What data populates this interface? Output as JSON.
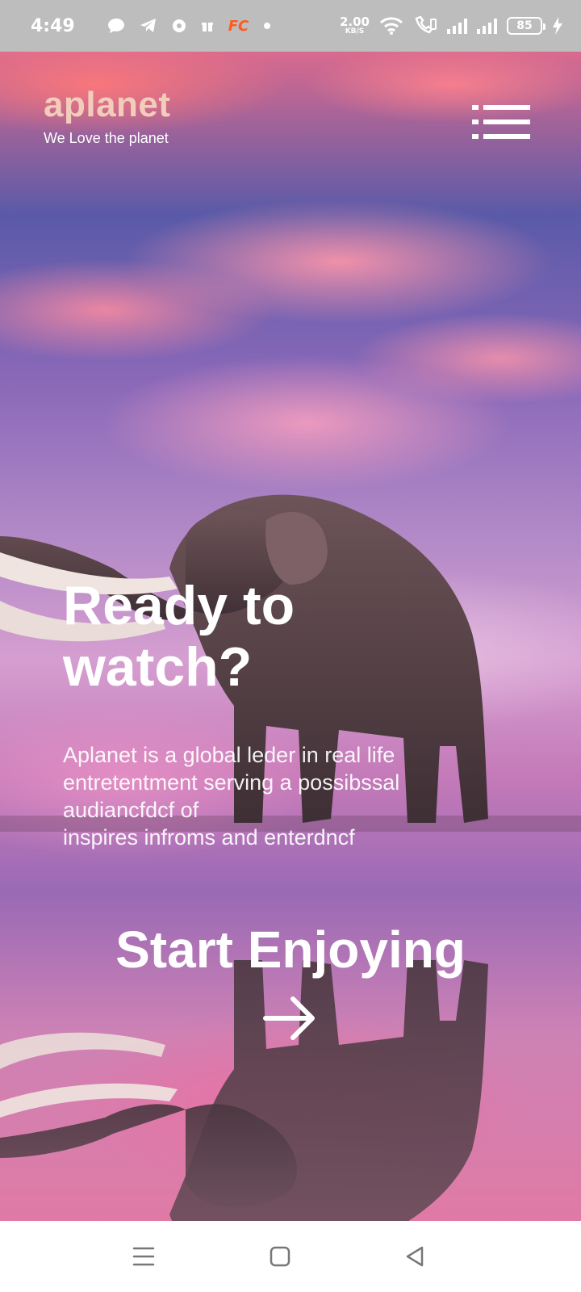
{
  "status_bar": {
    "time": "4:49",
    "fc_label": "FC",
    "net_speed_value": "2.00",
    "net_speed_unit": "KB/S",
    "battery_level": "85"
  },
  "header": {
    "brand_name": "aplanet",
    "tagline": "We Love the planet"
  },
  "hero": {
    "headline_line1": "Ready to",
    "headline_line2": "watch?",
    "description_lines": [
      "Aplanet is a global leder in real life",
      "entretentment serving a possibssal",
      "audiancfdcf of",
      "inspires infroms and enterdncf"
    ],
    "cta_label": "Start Enjoying"
  },
  "colors": {
    "brand": "#f2cdbb",
    "text": "#ffffff",
    "status_bar_bg": "#bdbdbd",
    "fc_badge": "#ff5a1f"
  },
  "icons": {
    "menu": "hamburger-menu-icon",
    "cta": "arrow-right-icon",
    "nav": [
      "recents-icon",
      "home-icon",
      "back-icon"
    ]
  }
}
